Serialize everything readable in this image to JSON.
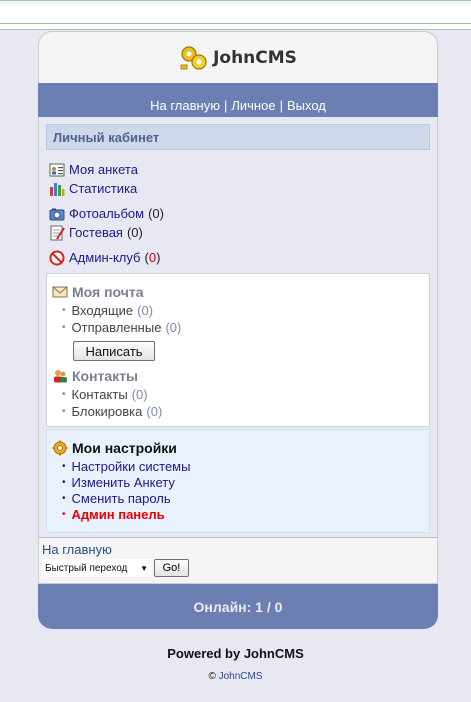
{
  "site": {
    "logo_text": "JohnCMS"
  },
  "nav": {
    "home": "На главную",
    "personal": "Личное",
    "logout": "Выход",
    "separator": "|"
  },
  "cabinet": {
    "title": "Личный кабинет",
    "items": [
      {
        "label": "Моя анкета",
        "icon": "profile-card-icon",
        "count": ""
      },
      {
        "label": "Статистика",
        "icon": "bar-chart-icon",
        "count": ""
      },
      {
        "label": "Фотоальбом",
        "icon": "camera-icon",
        "count": "(0)"
      },
      {
        "label": "Гостевая",
        "icon": "notepad-icon",
        "count": "(0)"
      },
      {
        "label": "Админ-клуб",
        "icon": "no-entry-icon",
        "count_open": "(",
        "count_num": "0",
        "count_close": ")"
      }
    ]
  },
  "mail": {
    "title": "Моя почта",
    "inbox": "Входящие",
    "inbox_count": "(0)",
    "sent": "Отправленные",
    "sent_count": "(0)",
    "write_button": "Написать"
  },
  "contacts": {
    "title": "Контакты",
    "contacts": "Контакты",
    "contacts_count": "(0)",
    "blocked": "Блокировка",
    "blocked_count": "(0)"
  },
  "settings": {
    "title": "Мои настройки",
    "links": [
      "Настройки системы",
      "Изменить Анкету",
      "Сменить пароль",
      "Админ панель"
    ]
  },
  "footer": {
    "home": "На главную",
    "jump_select": "Быстрый переход",
    "go_button": "Go!",
    "online": "Онлайн: 1 / 0",
    "powered": "Powered by JohnCMS",
    "copyright_symbol": "©",
    "copyright_link": "JohnCMS"
  },
  "colors": {
    "nav_bar": "#6b7fb3",
    "admin_link": "#ee0000",
    "link": "#1a1a8c"
  }
}
